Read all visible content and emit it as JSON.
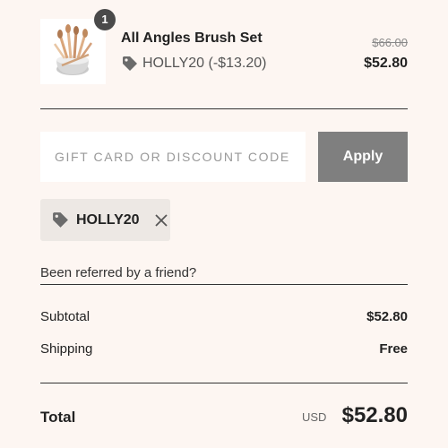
{
  "product": {
    "quantity": "1",
    "name": "All Angles Brush Set",
    "discount_label": "HOLLY20 (-$13.20)",
    "price_original": "$66.00",
    "price_current": "$52.80",
    "image": "brush-set-product-image"
  },
  "discount_form": {
    "placeholder": "GIFT CARD OR DISCOUNT CODE",
    "value": "",
    "apply_label": "Apply"
  },
  "applied_code": {
    "label": "HOLLY20",
    "icon": "tag-icon",
    "remove_icon": "close-icon"
  },
  "referral": {
    "text": "Been referred by a friend?"
  },
  "summary": {
    "subtotal_label": "Subtotal",
    "subtotal_value": "$52.80",
    "shipping_label": "Shipping",
    "shipping_value": "Free"
  },
  "total": {
    "label": "Total",
    "currency": "USD",
    "amount": "$52.80"
  },
  "colors": {
    "background": "#fdf6f2",
    "apply_button": "#7f7f7f",
    "chip_background": "#ede8e4",
    "badge": "#4a4a4a"
  }
}
